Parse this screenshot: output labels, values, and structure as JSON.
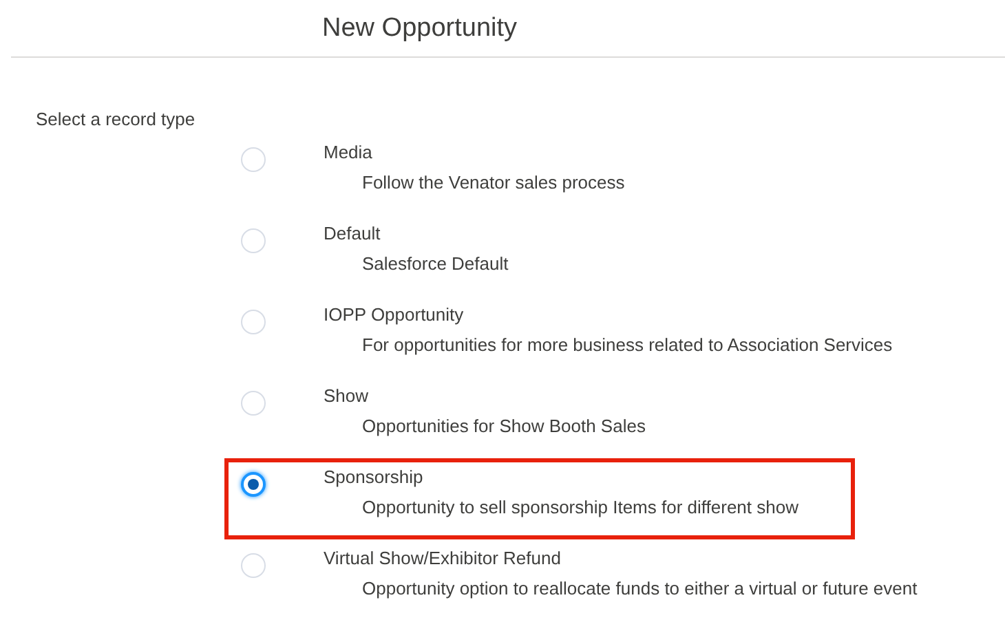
{
  "title": "New Opportunity",
  "prompt": "Select a record type",
  "options": [
    {
      "label": "Media",
      "description": "Follow the Venator sales process",
      "selected": false,
      "highlighted": false
    },
    {
      "label": "Default",
      "description": "Salesforce Default",
      "selected": false,
      "highlighted": false
    },
    {
      "label": "IOPP Opportunity",
      "description": "For opportunities for more business related to Association Services",
      "selected": false,
      "highlighted": false
    },
    {
      "label": "Show",
      "description": "Opportunities for Show Booth Sales",
      "selected": false,
      "highlighted": false
    },
    {
      "label": "Sponsorship",
      "description": "Opportunity to sell sponsorship Items for different show",
      "selected": true,
      "highlighted": true
    },
    {
      "label": "Virtual Show/Exhibitor Refund",
      "description": "Opportunity option to reallocate funds to either a virtual or future event",
      "selected": false,
      "highlighted": false
    }
  ]
}
